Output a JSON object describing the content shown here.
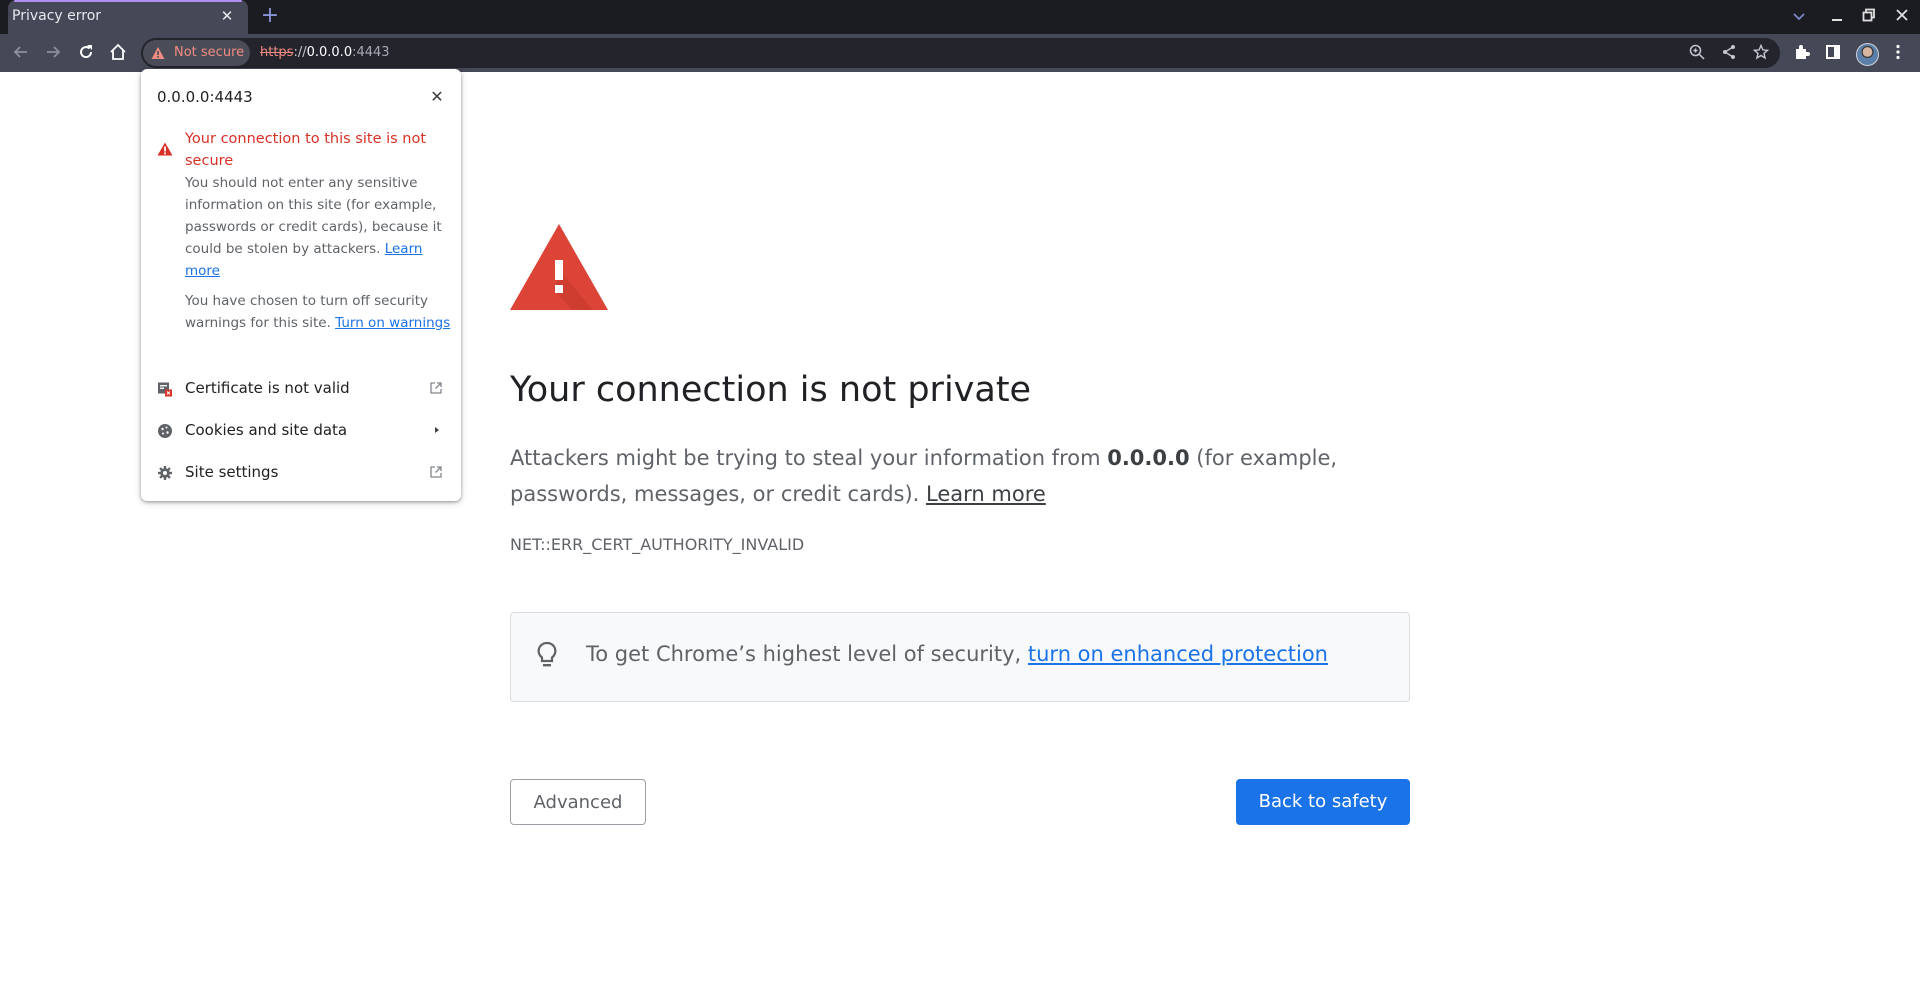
{
  "window": {
    "tab_title": "Privacy error",
    "tab_close_glyph": "✕",
    "new_tab_glyph": "+",
    "tab_search_glyph": "⌄",
    "minimize_glyph": "_",
    "restore_glyph": "❐",
    "close_glyph": "✕"
  },
  "toolbar": {
    "back_glyph": "←",
    "forward_glyph": "→",
    "reload_glyph": "↻",
    "home_glyph": "⌂",
    "security_chip_label": "Not secure",
    "url": {
      "scheme": "https",
      "separator": "://",
      "host": "0.0.0.0",
      "port": ":4443"
    },
    "zoom_glyph": "⊕",
    "share_glyph": "<",
    "bookmark_glyph": "☆",
    "extensions_glyph": "✚",
    "menu_glyph": "⋮"
  },
  "page": {
    "heading": "Your connection is not private",
    "para_before": "Attackers might be trying to steal your information from ",
    "para_host": "0.0.0.0",
    "para_after": " (for example, passwords, messages, or credit cards). ",
    "learn_more": "Learn more",
    "error_code": "NET::ERR_CERT_AUTHORITY_INVALID",
    "enhanced_text": "To get Chrome’s highest level of security, ",
    "enhanced_link": "turn on enhanced protection",
    "advanced_button": "Advanced",
    "back_button": "Back to safety"
  },
  "popup": {
    "title": "0.0.0.0:4443",
    "close_glyph": "✕",
    "warning_title": "Your connection to this site is not secure",
    "warning_body": "You should not enter any sensitive information on this site (for example, passwords or credit cards), because it could be stolen by attackers. ",
    "warning_link": "Learn more",
    "warnings_off_body": "You have chosen to turn off security warnings for this site. ",
    "warnings_off_link": "Turn on warnings",
    "rows": [
      {
        "label": "Certificate is not valid",
        "action_glyph": "↗"
      },
      {
        "label": "Cookies and site data",
        "action_glyph": "▸"
      },
      {
        "label": "Site settings",
        "action_glyph": "↗"
      }
    ]
  },
  "colors": {
    "accent_blue": "#1a73e8",
    "error_red": "#d93025",
    "warning_triangle": "#db4437",
    "tab_indicator": "#b28cf0"
  }
}
